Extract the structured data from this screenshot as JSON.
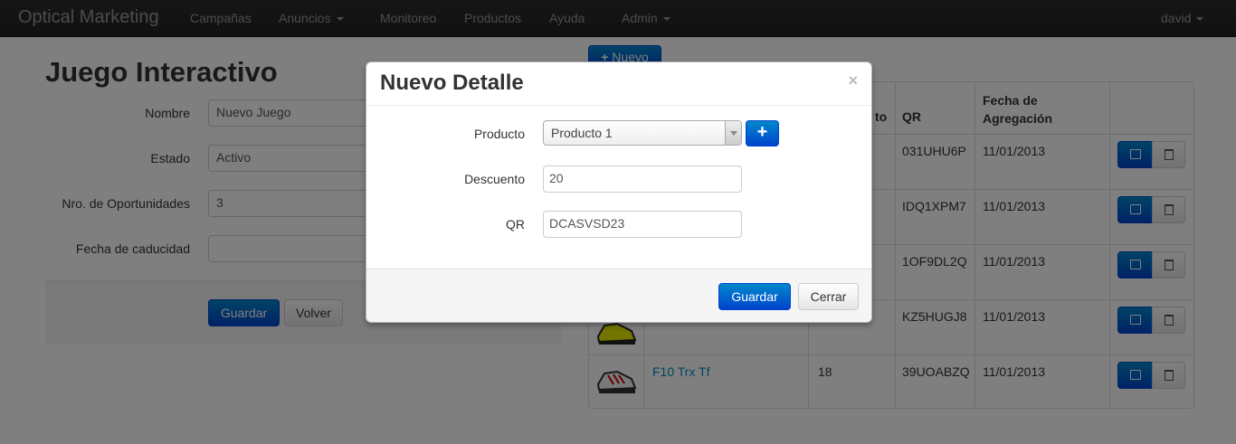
{
  "navbar": {
    "brand": "Optical Marketing",
    "items": [
      {
        "label": "Campañas",
        "dropdown": false
      },
      {
        "label": "Anuncios",
        "dropdown": true
      },
      {
        "label": "Monitoreo",
        "dropdown": false
      },
      {
        "label": "Productos",
        "dropdown": false
      },
      {
        "label": "Ayuda",
        "dropdown": false
      },
      {
        "label": "Admin",
        "dropdown": true
      }
    ],
    "user": "david"
  },
  "form": {
    "title": "Juego Interactivo",
    "fields": [
      {
        "label": "Nombre",
        "value": "Nuevo Juego"
      },
      {
        "label": "Estado",
        "value": "Activo"
      },
      {
        "label": "Nro. de Oportunidades",
        "value": "3"
      },
      {
        "label": "Fecha de caducidad",
        "value": ""
      }
    ],
    "save_label": "Guardar",
    "back_label": "Volver"
  },
  "details": {
    "new_label": "Nuevo",
    "headers": [
      "to",
      "QR",
      "Fecha de Agregación"
    ],
    "rows": [
      {
        "product": "",
        "discount": "",
        "qr": "031UHU6P",
        "date": "11/01/2013"
      },
      {
        "product": "",
        "discount": "",
        "qr": "IDQ1XPM7",
        "date": "11/01/2013"
      },
      {
        "product": "",
        "discount": "",
        "qr": "1OF9DL2Q",
        "date": "11/01/2013"
      },
      {
        "product": "",
        "discount": "",
        "qr": "KZ5HUGJ8",
        "date": "11/01/2013"
      },
      {
        "product": "F10 Trx Tf",
        "discount": "18",
        "qr": "39UOABZQ",
        "date": "11/01/2013"
      }
    ]
  },
  "modal": {
    "title": "Nuevo Detalle",
    "close_symbol": "×",
    "product_label": "Producto",
    "product_value": "Producto 1",
    "add_symbol": "+",
    "discount_label": "Descuento",
    "discount_value": "20",
    "qr_label": "QR",
    "qr_value": "DCASVSD23",
    "save_label": "Guardar",
    "close_label": "Cerrar"
  },
  "colors": {
    "primary": "#0088cc",
    "link": "#0088cc",
    "navbar": "#222222"
  }
}
